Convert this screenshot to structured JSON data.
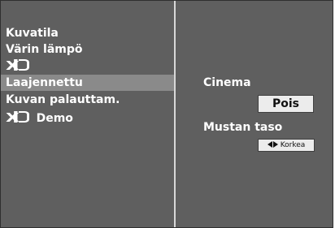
{
  "menu": {
    "items": [
      {
        "label": "Kuvatila",
        "selected": false
      },
      {
        "label": "Värin lämpö",
        "selected": false
      },
      {
        "label": "XD",
        "selected": false,
        "icon": "xd-logo"
      },
      {
        "label": "Laajennettu",
        "selected": true
      },
      {
        "label": "Kuvan palauttam.",
        "selected": false
      },
      {
        "label": "Demo",
        "selected": false,
        "icon": "xd-logo"
      }
    ]
  },
  "settings": {
    "cinema": {
      "label": "Cinema",
      "value": "Pois"
    },
    "black_level": {
      "label": "Mustan taso",
      "value": "Korkea"
    }
  },
  "colors": {
    "panel": "#5f5f5f",
    "selected_row": "#8a8a8a",
    "divider": "#d8d8d8",
    "value_box": "#ececec"
  }
}
